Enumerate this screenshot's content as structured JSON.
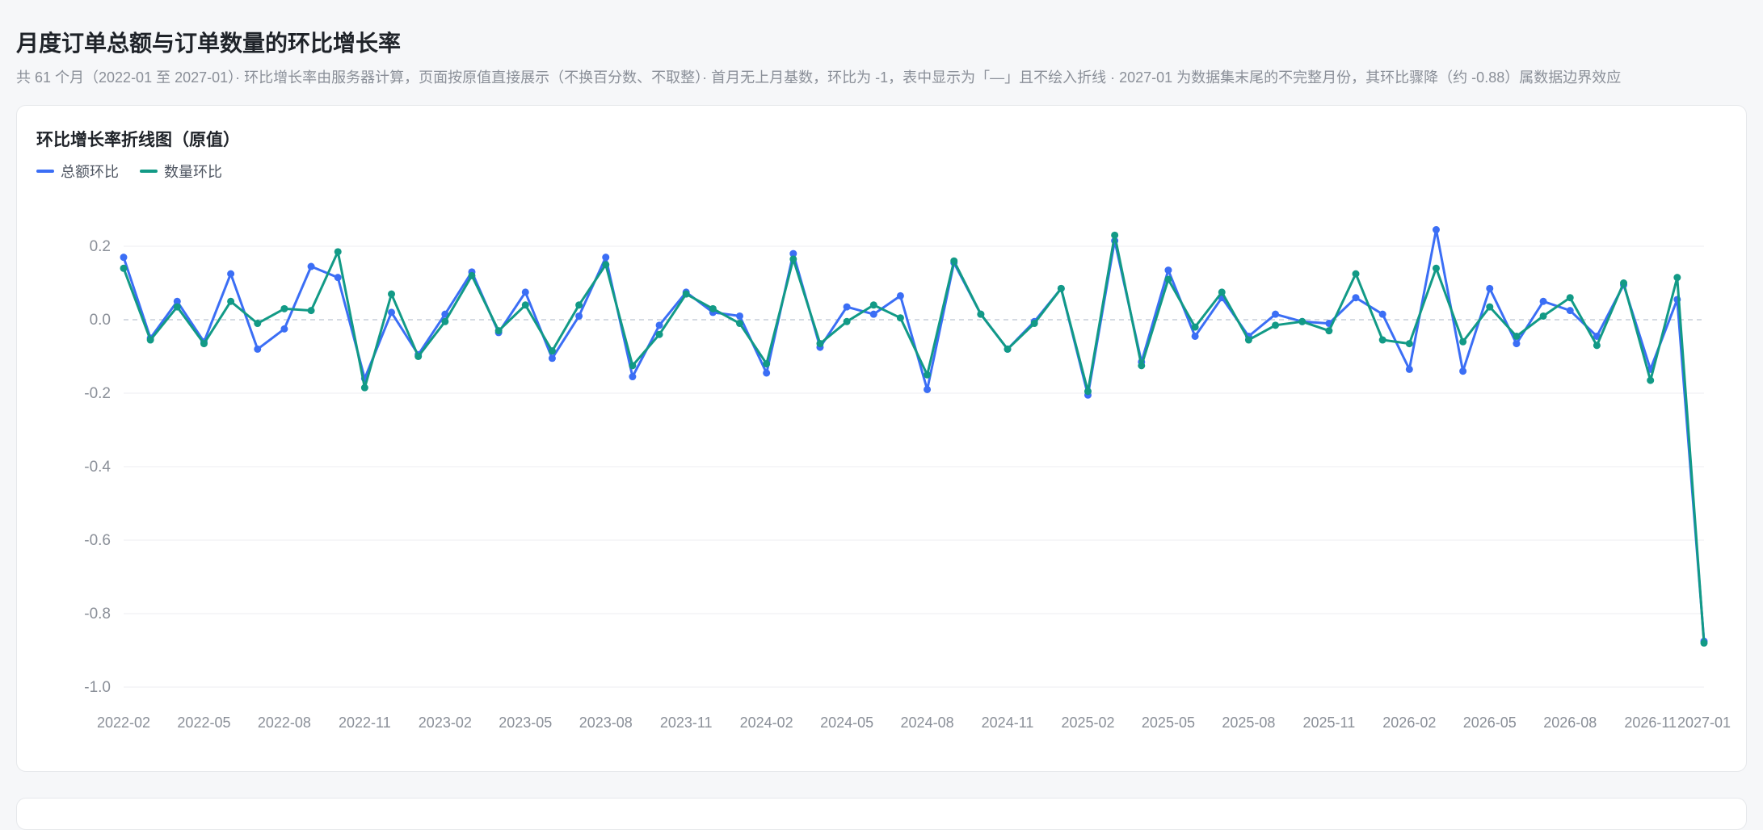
{
  "page": {
    "title": "月度订单总额与订单数量的环比增长率",
    "subtitle": "共 61 个月（2022-01 至 2027-01）· 环比增长率由服务器计算，页面按原值直接展示（不换百分数、不取整）· 首月无上月基数，环比为 -1，表中显示为「—」且不绘入折线 · 2027-01 为数据集末尾的不完整月份，其环比骤降（约 -0.88）属数据边界效应"
  },
  "colors": {
    "amount": "#3b6ef5",
    "count": "#129a86",
    "grid": "#eceef1",
    "zero_line": "#c7cdd8",
    "tick_text": "#8a8f98"
  },
  "chart_data": {
    "type": "line",
    "title": "环比增长率折线图（原值）",
    "xlabel": "",
    "ylabel": "",
    "ylim": [
      -1.0,
      0.25
    ],
    "yticks": [
      -1.0,
      -0.8,
      -0.6,
      -0.4,
      -0.2,
      0.0,
      0.2
    ],
    "ytick_labels": [
      "-1.0",
      "-0.8",
      "-0.6",
      "-0.4",
      "-0.2",
      "0.0",
      "0.2"
    ],
    "grid": true,
    "legend_position": "top-left",
    "x": [
      "2022-02",
      "2022-03",
      "2022-04",
      "2022-05",
      "2022-06",
      "2022-07",
      "2022-08",
      "2022-09",
      "2022-10",
      "2022-11",
      "2022-12",
      "2023-01",
      "2023-02",
      "2023-03",
      "2023-04",
      "2023-05",
      "2023-06",
      "2023-07",
      "2023-08",
      "2023-09",
      "2023-10",
      "2023-11",
      "2023-12",
      "2024-01",
      "2024-02",
      "2024-03",
      "2024-04",
      "2024-05",
      "2024-06",
      "2024-07",
      "2024-08",
      "2024-09",
      "2024-10",
      "2024-11",
      "2024-12",
      "2025-01",
      "2025-02",
      "2025-03",
      "2025-04",
      "2025-05",
      "2025-06",
      "2025-07",
      "2025-08",
      "2025-09",
      "2025-10",
      "2025-11",
      "2025-12",
      "2026-01",
      "2026-02",
      "2026-03",
      "2026-04",
      "2026-05",
      "2026-06",
      "2026-07",
      "2026-08",
      "2026-09",
      "2026-10",
      "2026-11",
      "2026-12",
      "2027-01"
    ],
    "x_tick_labels": [
      "2022-02",
      "2022-05",
      "2022-08",
      "2022-11",
      "2023-02",
      "2023-05",
      "2023-08",
      "2023-11",
      "2024-02",
      "2024-05",
      "2024-08",
      "2024-11",
      "2025-02",
      "2025-05",
      "2025-08",
      "2025-11",
      "2026-02",
      "2026-05",
      "2026-08",
      "2026-11",
      "2027-01"
    ],
    "series": [
      {
        "name": "总额环比",
        "color": "#3b6ef5",
        "values": [
          0.17,
          -0.05,
          0.05,
          -0.06,
          0.125,
          -0.08,
          -0.025,
          0.145,
          0.115,
          -0.16,
          0.02,
          -0.095,
          0.015,
          0.13,
          -0.035,
          0.075,
          -0.105,
          0.01,
          0.17,
          -0.155,
          -0.015,
          0.075,
          0.02,
          0.01,
          -0.145,
          0.18,
          -0.075,
          0.035,
          0.015,
          0.065,
          -0.19,
          0.155,
          0.015,
          -0.08,
          -0.005,
          0.085,
          -0.205,
          0.215,
          -0.115,
          0.135,
          -0.045,
          0.06,
          -0.045,
          0.015,
          -0.005,
          -0.01,
          0.06,
          0.015,
          -0.135,
          0.245,
          -0.14,
          0.085,
          -0.065,
          0.05,
          0.025,
          -0.045,
          0.095,
          -0.135,
          0.055,
          -0.875
        ]
      },
      {
        "name": "数量环比",
        "color": "#129a86",
        "values": [
          0.14,
          -0.055,
          0.035,
          -0.065,
          0.05,
          -0.01,
          0.03,
          0.025,
          0.185,
          -0.185,
          0.07,
          -0.1,
          -0.005,
          0.12,
          -0.03,
          0.04,
          -0.085,
          0.04,
          0.15,
          -0.125,
          -0.04,
          0.07,
          0.03,
          -0.01,
          -0.12,
          0.165,
          -0.065,
          -0.005,
          0.04,
          0.005,
          -0.15,
          0.16,
          0.015,
          -0.08,
          -0.01,
          0.085,
          -0.195,
          0.23,
          -0.125,
          0.11,
          -0.02,
          0.075,
          -0.055,
          -0.015,
          -0.005,
          -0.03,
          0.125,
          -0.055,
          -0.065,
          0.14,
          -0.06,
          0.035,
          -0.045,
          0.01,
          0.06,
          -0.07,
          0.1,
          -0.165,
          0.115,
          -0.88
        ]
      }
    ]
  }
}
